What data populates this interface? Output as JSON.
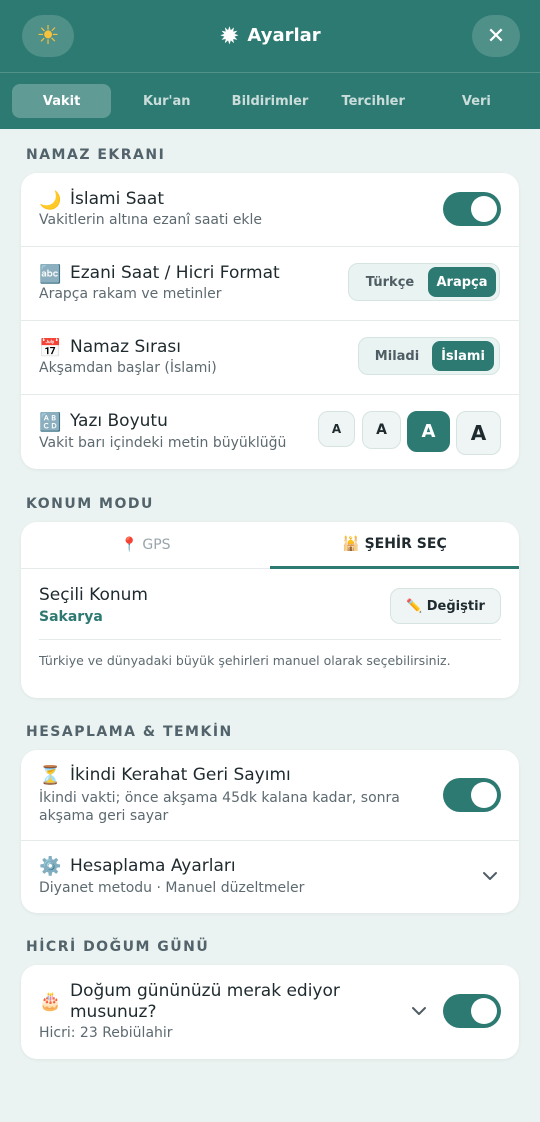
{
  "header": {
    "title": "Ayarlar",
    "gear_icon": "✹",
    "theme_icon": "☀",
    "close_icon": "✕",
    "tabs": [
      {
        "label": "Vakit",
        "active": true
      },
      {
        "label": "Kur'an",
        "active": false
      },
      {
        "label": "Bildirimler",
        "active": false
      },
      {
        "label": "Tercihler",
        "active": false
      },
      {
        "label": "Veri",
        "active": false
      }
    ]
  },
  "namaz": {
    "section_title": "NAMAZ EKRANI",
    "islami_saat": {
      "icon": "🌙",
      "title": "İslami Saat",
      "subtitle": "Vakitlerin altına ezanî saati ekle",
      "enabled": true
    },
    "ezani": {
      "icon": "🔤",
      "title": "Ezani Saat / Hicri Format",
      "subtitle": "Arapça rakam ve metinler",
      "options": [
        "Türkçe",
        "Arapça"
      ],
      "selected": "Arapça"
    },
    "sira": {
      "icon": "📅",
      "title": "Namaz Sırası",
      "subtitle": "Akşamdan başlar (İslami)",
      "options": [
        "Miladi",
        "İslami"
      ],
      "selected": "İslami"
    },
    "yazi": {
      "icon": "🔠",
      "title": "Yazı Boyutu",
      "subtitle": "Vakit barı içindeki metin büyüklüğü",
      "sizes": [
        "A",
        "A",
        "A",
        "A"
      ],
      "selected_index": 2
    }
  },
  "konum": {
    "section_title": "KONUM MODU",
    "tab_gps": "📍 GPS",
    "tab_city": "🕌 ŞEHİR SEÇ",
    "selected_label": "Seçili Konum",
    "selected_value": "Sakarya",
    "edit_label": "✏️ Değiştir",
    "info": "Türkiye ve dünyadaki büyük şehirleri manuel olarak seçebilirsiniz."
  },
  "hesaplama": {
    "section_title": "HESAPLAMA & TEMKİN",
    "kerahat": {
      "icon": "⏳",
      "title": "İkindi Kerahat Geri Sayımı",
      "subtitle_line1": "İkindi vakti; önce akşama 45dk kalana kadar, sonra",
      "subtitle_line2": "akşama geri sayar",
      "enabled": true
    },
    "ayarlar": {
      "icon": "⚙️",
      "title": "Hesaplama Ayarları",
      "subtitle": "Diyanet metodu · Manuel düzeltmeler"
    }
  },
  "hicri": {
    "section_title": "HİCRİ DOĞUM GÜNÜ",
    "icon": "🎂",
    "title_line1": "Doğum gününüzü merak ediyor",
    "title_line2": "musunuz?",
    "subtitle": "Hicri: 23 Rebiülahir",
    "enabled": true
  },
  "colors": {
    "accent": "#2d7a72",
    "header": "#2c7a72",
    "background": "#eaf3f1"
  }
}
